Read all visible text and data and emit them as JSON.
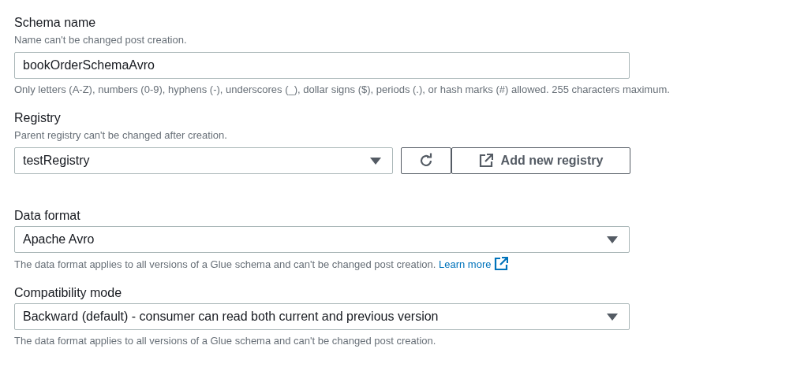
{
  "fields": [
    {
      "kind": "text",
      "label": "Schema name",
      "description": "Name can't be changed post creation.",
      "value": "bookOrderSchemaAvro",
      "help": "Only letters (A-Z), numbers (0-9), hyphens (-), underscores (_), dollar signs ($), periods (.), or hash marks (#) allowed. 255 characters maximum."
    },
    {
      "kind": "select",
      "label": "Registry",
      "description": "Parent registry can't be changed after creation.",
      "value": "testRegistry",
      "actions": [
        {
          "kind": "refresh"
        },
        {
          "kind": "external",
          "label": "Add new registry"
        }
      ]
    },
    {
      "kind": "select",
      "label": "Data format",
      "value": "Apache Avro",
      "help": "The data format applies to all versions of a Glue schema and can't be changed post creation.",
      "help_link": "Learn more"
    },
    {
      "kind": "select",
      "label": "Compatibility mode",
      "value": "Backward (default) - consumer can read both current and previous version",
      "help": "The data format applies to all versions of a Glue schema and can't be changed post creation."
    }
  ]
}
